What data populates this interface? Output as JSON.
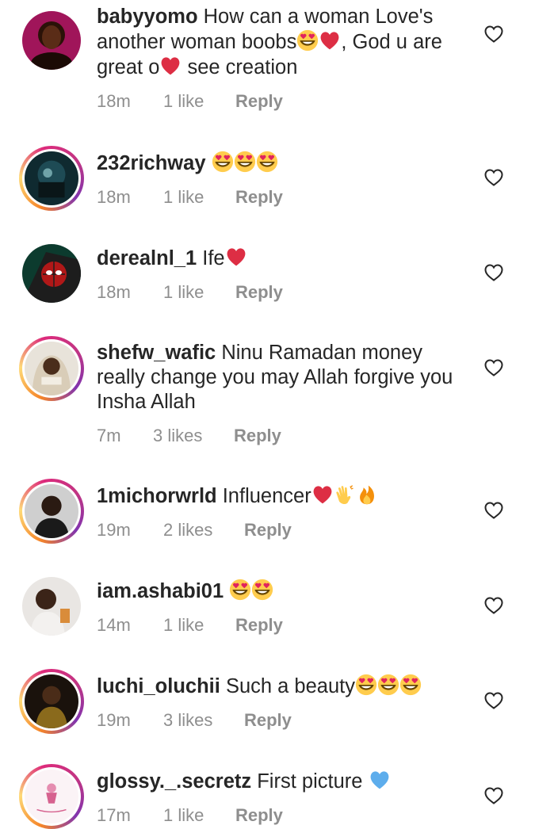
{
  "comments": [
    {
      "username": "babyyomo",
      "text_before": "How can a woman Love's another woman boobs",
      "text_after": ", God u are great o",
      "text_end": " see creation",
      "time": "18m",
      "likes": "1 like",
      "reply": "Reply",
      "avatar": "woman-portrait"
    },
    {
      "username": "232richway",
      "text": "",
      "time": "18m",
      "likes": "1 like",
      "reply": "Reply",
      "avatar": "dark-scene"
    },
    {
      "username": "derealnl_1",
      "text": "Ife",
      "time": "18m",
      "likes": "1 like",
      "reply": "Reply",
      "avatar": "spiderman"
    },
    {
      "username": "shefw_wafic",
      "text": "Ninu Ramadan money really change you may Allah forgive you Insha Allah",
      "time": "7m",
      "likes": "3 likes",
      "reply": "Reply",
      "avatar": "hoodie-person"
    },
    {
      "username": "1michorwrld",
      "text": "Influencer",
      "time": "19m",
      "likes": "2 likes",
      "reply": "Reply",
      "avatar": "man-portrait"
    },
    {
      "username": "iam.ashabi01",
      "text": "",
      "time": "14m",
      "likes": "1 like",
      "reply": "Reply",
      "avatar": "woman-light"
    },
    {
      "username": "luchi_oluchii",
      "text": "Such a beauty",
      "time": "19m",
      "likes": "3 likes",
      "reply": "Reply",
      "avatar": "woman-dark"
    },
    {
      "username": "glossy._.secretz",
      "text": "First picture",
      "time": "17m",
      "likes": "1 like",
      "reply": "Reply",
      "avatar": "brand-logo"
    }
  ],
  "icons": {
    "like": "heart-outline-icon",
    "emoji_heart_eyes": "heart-eyes-emoji",
    "emoji_red_heart": "red-heart-emoji",
    "emoji_clap": "clapping-hands-emoji",
    "emoji_fire": "fire-emoji",
    "emoji_blue_heart": "blue-heart-emoji"
  },
  "colors": {
    "text": "#262626",
    "meta": "#8e8e8e",
    "background": "#ffffff"
  }
}
